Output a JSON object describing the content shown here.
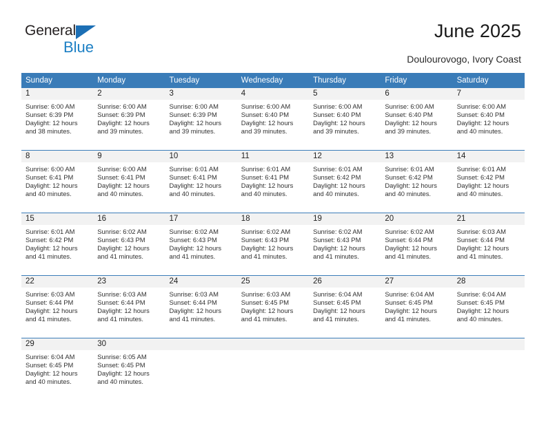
{
  "brand": {
    "name_part1": "General",
    "name_part2": "Blue",
    "triangle_color": "#1c6fb5",
    "blue_text_color": "#1c7fc4"
  },
  "header": {
    "title": "June 2025",
    "subtitle": "Doulourovogo, Ivory Coast"
  },
  "calendar": {
    "accent_color": "#3a7cb8",
    "daynum_band_color": "#f2f2f2",
    "weekdays": [
      "Sunday",
      "Monday",
      "Tuesday",
      "Wednesday",
      "Thursday",
      "Friday",
      "Saturday"
    ],
    "weeks": [
      [
        {
          "day": "1",
          "sunrise": "Sunrise: 6:00 AM",
          "sunset": "Sunset: 6:39 PM",
          "daylight_line1": "Daylight: 12 hours",
          "daylight_line2": "and 38 minutes."
        },
        {
          "day": "2",
          "sunrise": "Sunrise: 6:00 AM",
          "sunset": "Sunset: 6:39 PM",
          "daylight_line1": "Daylight: 12 hours",
          "daylight_line2": "and 39 minutes."
        },
        {
          "day": "3",
          "sunrise": "Sunrise: 6:00 AM",
          "sunset": "Sunset: 6:39 PM",
          "daylight_line1": "Daylight: 12 hours",
          "daylight_line2": "and 39 minutes."
        },
        {
          "day": "4",
          "sunrise": "Sunrise: 6:00 AM",
          "sunset": "Sunset: 6:40 PM",
          "daylight_line1": "Daylight: 12 hours",
          "daylight_line2": "and 39 minutes."
        },
        {
          "day": "5",
          "sunrise": "Sunrise: 6:00 AM",
          "sunset": "Sunset: 6:40 PM",
          "daylight_line1": "Daylight: 12 hours",
          "daylight_line2": "and 39 minutes."
        },
        {
          "day": "6",
          "sunrise": "Sunrise: 6:00 AM",
          "sunset": "Sunset: 6:40 PM",
          "daylight_line1": "Daylight: 12 hours",
          "daylight_line2": "and 39 minutes."
        },
        {
          "day": "7",
          "sunrise": "Sunrise: 6:00 AM",
          "sunset": "Sunset: 6:40 PM",
          "daylight_line1": "Daylight: 12 hours",
          "daylight_line2": "and 40 minutes."
        }
      ],
      [
        {
          "day": "8",
          "sunrise": "Sunrise: 6:00 AM",
          "sunset": "Sunset: 6:41 PM",
          "daylight_line1": "Daylight: 12 hours",
          "daylight_line2": "and 40 minutes."
        },
        {
          "day": "9",
          "sunrise": "Sunrise: 6:00 AM",
          "sunset": "Sunset: 6:41 PM",
          "daylight_line1": "Daylight: 12 hours",
          "daylight_line2": "and 40 minutes."
        },
        {
          "day": "10",
          "sunrise": "Sunrise: 6:01 AM",
          "sunset": "Sunset: 6:41 PM",
          "daylight_line1": "Daylight: 12 hours",
          "daylight_line2": "and 40 minutes."
        },
        {
          "day": "11",
          "sunrise": "Sunrise: 6:01 AM",
          "sunset": "Sunset: 6:41 PM",
          "daylight_line1": "Daylight: 12 hours",
          "daylight_line2": "and 40 minutes."
        },
        {
          "day": "12",
          "sunrise": "Sunrise: 6:01 AM",
          "sunset": "Sunset: 6:42 PM",
          "daylight_line1": "Daylight: 12 hours",
          "daylight_line2": "and 40 minutes."
        },
        {
          "day": "13",
          "sunrise": "Sunrise: 6:01 AM",
          "sunset": "Sunset: 6:42 PM",
          "daylight_line1": "Daylight: 12 hours",
          "daylight_line2": "and 40 minutes."
        },
        {
          "day": "14",
          "sunrise": "Sunrise: 6:01 AM",
          "sunset": "Sunset: 6:42 PM",
          "daylight_line1": "Daylight: 12 hours",
          "daylight_line2": "and 40 minutes."
        }
      ],
      [
        {
          "day": "15",
          "sunrise": "Sunrise: 6:01 AM",
          "sunset": "Sunset: 6:42 PM",
          "daylight_line1": "Daylight: 12 hours",
          "daylight_line2": "and 41 minutes."
        },
        {
          "day": "16",
          "sunrise": "Sunrise: 6:02 AM",
          "sunset": "Sunset: 6:43 PM",
          "daylight_line1": "Daylight: 12 hours",
          "daylight_line2": "and 41 minutes."
        },
        {
          "day": "17",
          "sunrise": "Sunrise: 6:02 AM",
          "sunset": "Sunset: 6:43 PM",
          "daylight_line1": "Daylight: 12 hours",
          "daylight_line2": "and 41 minutes."
        },
        {
          "day": "18",
          "sunrise": "Sunrise: 6:02 AM",
          "sunset": "Sunset: 6:43 PM",
          "daylight_line1": "Daylight: 12 hours",
          "daylight_line2": "and 41 minutes."
        },
        {
          "day": "19",
          "sunrise": "Sunrise: 6:02 AM",
          "sunset": "Sunset: 6:43 PM",
          "daylight_line1": "Daylight: 12 hours",
          "daylight_line2": "and 41 minutes."
        },
        {
          "day": "20",
          "sunrise": "Sunrise: 6:02 AM",
          "sunset": "Sunset: 6:44 PM",
          "daylight_line1": "Daylight: 12 hours",
          "daylight_line2": "and 41 minutes."
        },
        {
          "day": "21",
          "sunrise": "Sunrise: 6:03 AM",
          "sunset": "Sunset: 6:44 PM",
          "daylight_line1": "Daylight: 12 hours",
          "daylight_line2": "and 41 minutes."
        }
      ],
      [
        {
          "day": "22",
          "sunrise": "Sunrise: 6:03 AM",
          "sunset": "Sunset: 6:44 PM",
          "daylight_line1": "Daylight: 12 hours",
          "daylight_line2": "and 41 minutes."
        },
        {
          "day": "23",
          "sunrise": "Sunrise: 6:03 AM",
          "sunset": "Sunset: 6:44 PM",
          "daylight_line1": "Daylight: 12 hours",
          "daylight_line2": "and 41 minutes."
        },
        {
          "day": "24",
          "sunrise": "Sunrise: 6:03 AM",
          "sunset": "Sunset: 6:44 PM",
          "daylight_line1": "Daylight: 12 hours",
          "daylight_line2": "and 41 minutes."
        },
        {
          "day": "25",
          "sunrise": "Sunrise: 6:03 AM",
          "sunset": "Sunset: 6:45 PM",
          "daylight_line1": "Daylight: 12 hours",
          "daylight_line2": "and 41 minutes."
        },
        {
          "day": "26",
          "sunrise": "Sunrise: 6:04 AM",
          "sunset": "Sunset: 6:45 PM",
          "daylight_line1": "Daylight: 12 hours",
          "daylight_line2": "and 41 minutes."
        },
        {
          "day": "27",
          "sunrise": "Sunrise: 6:04 AM",
          "sunset": "Sunset: 6:45 PM",
          "daylight_line1": "Daylight: 12 hours",
          "daylight_line2": "and 41 minutes."
        },
        {
          "day": "28",
          "sunrise": "Sunrise: 6:04 AM",
          "sunset": "Sunset: 6:45 PM",
          "daylight_line1": "Daylight: 12 hours",
          "daylight_line2": "and 40 minutes."
        }
      ],
      [
        {
          "day": "29",
          "sunrise": "Sunrise: 6:04 AM",
          "sunset": "Sunset: 6:45 PM",
          "daylight_line1": "Daylight: 12 hours",
          "daylight_line2": "and 40 minutes."
        },
        {
          "day": "30",
          "sunrise": "Sunrise: 6:05 AM",
          "sunset": "Sunset: 6:45 PM",
          "daylight_line1": "Daylight: 12 hours",
          "daylight_line2": "and 40 minutes."
        },
        {
          "day": "",
          "sunrise": "",
          "sunset": "",
          "daylight_line1": "",
          "daylight_line2": ""
        },
        {
          "day": "",
          "sunrise": "",
          "sunset": "",
          "daylight_line1": "",
          "daylight_line2": ""
        },
        {
          "day": "",
          "sunrise": "",
          "sunset": "",
          "daylight_line1": "",
          "daylight_line2": ""
        },
        {
          "day": "",
          "sunrise": "",
          "sunset": "",
          "daylight_line1": "",
          "daylight_line2": ""
        },
        {
          "day": "",
          "sunrise": "",
          "sunset": "",
          "daylight_line1": "",
          "daylight_line2": ""
        }
      ]
    ]
  }
}
